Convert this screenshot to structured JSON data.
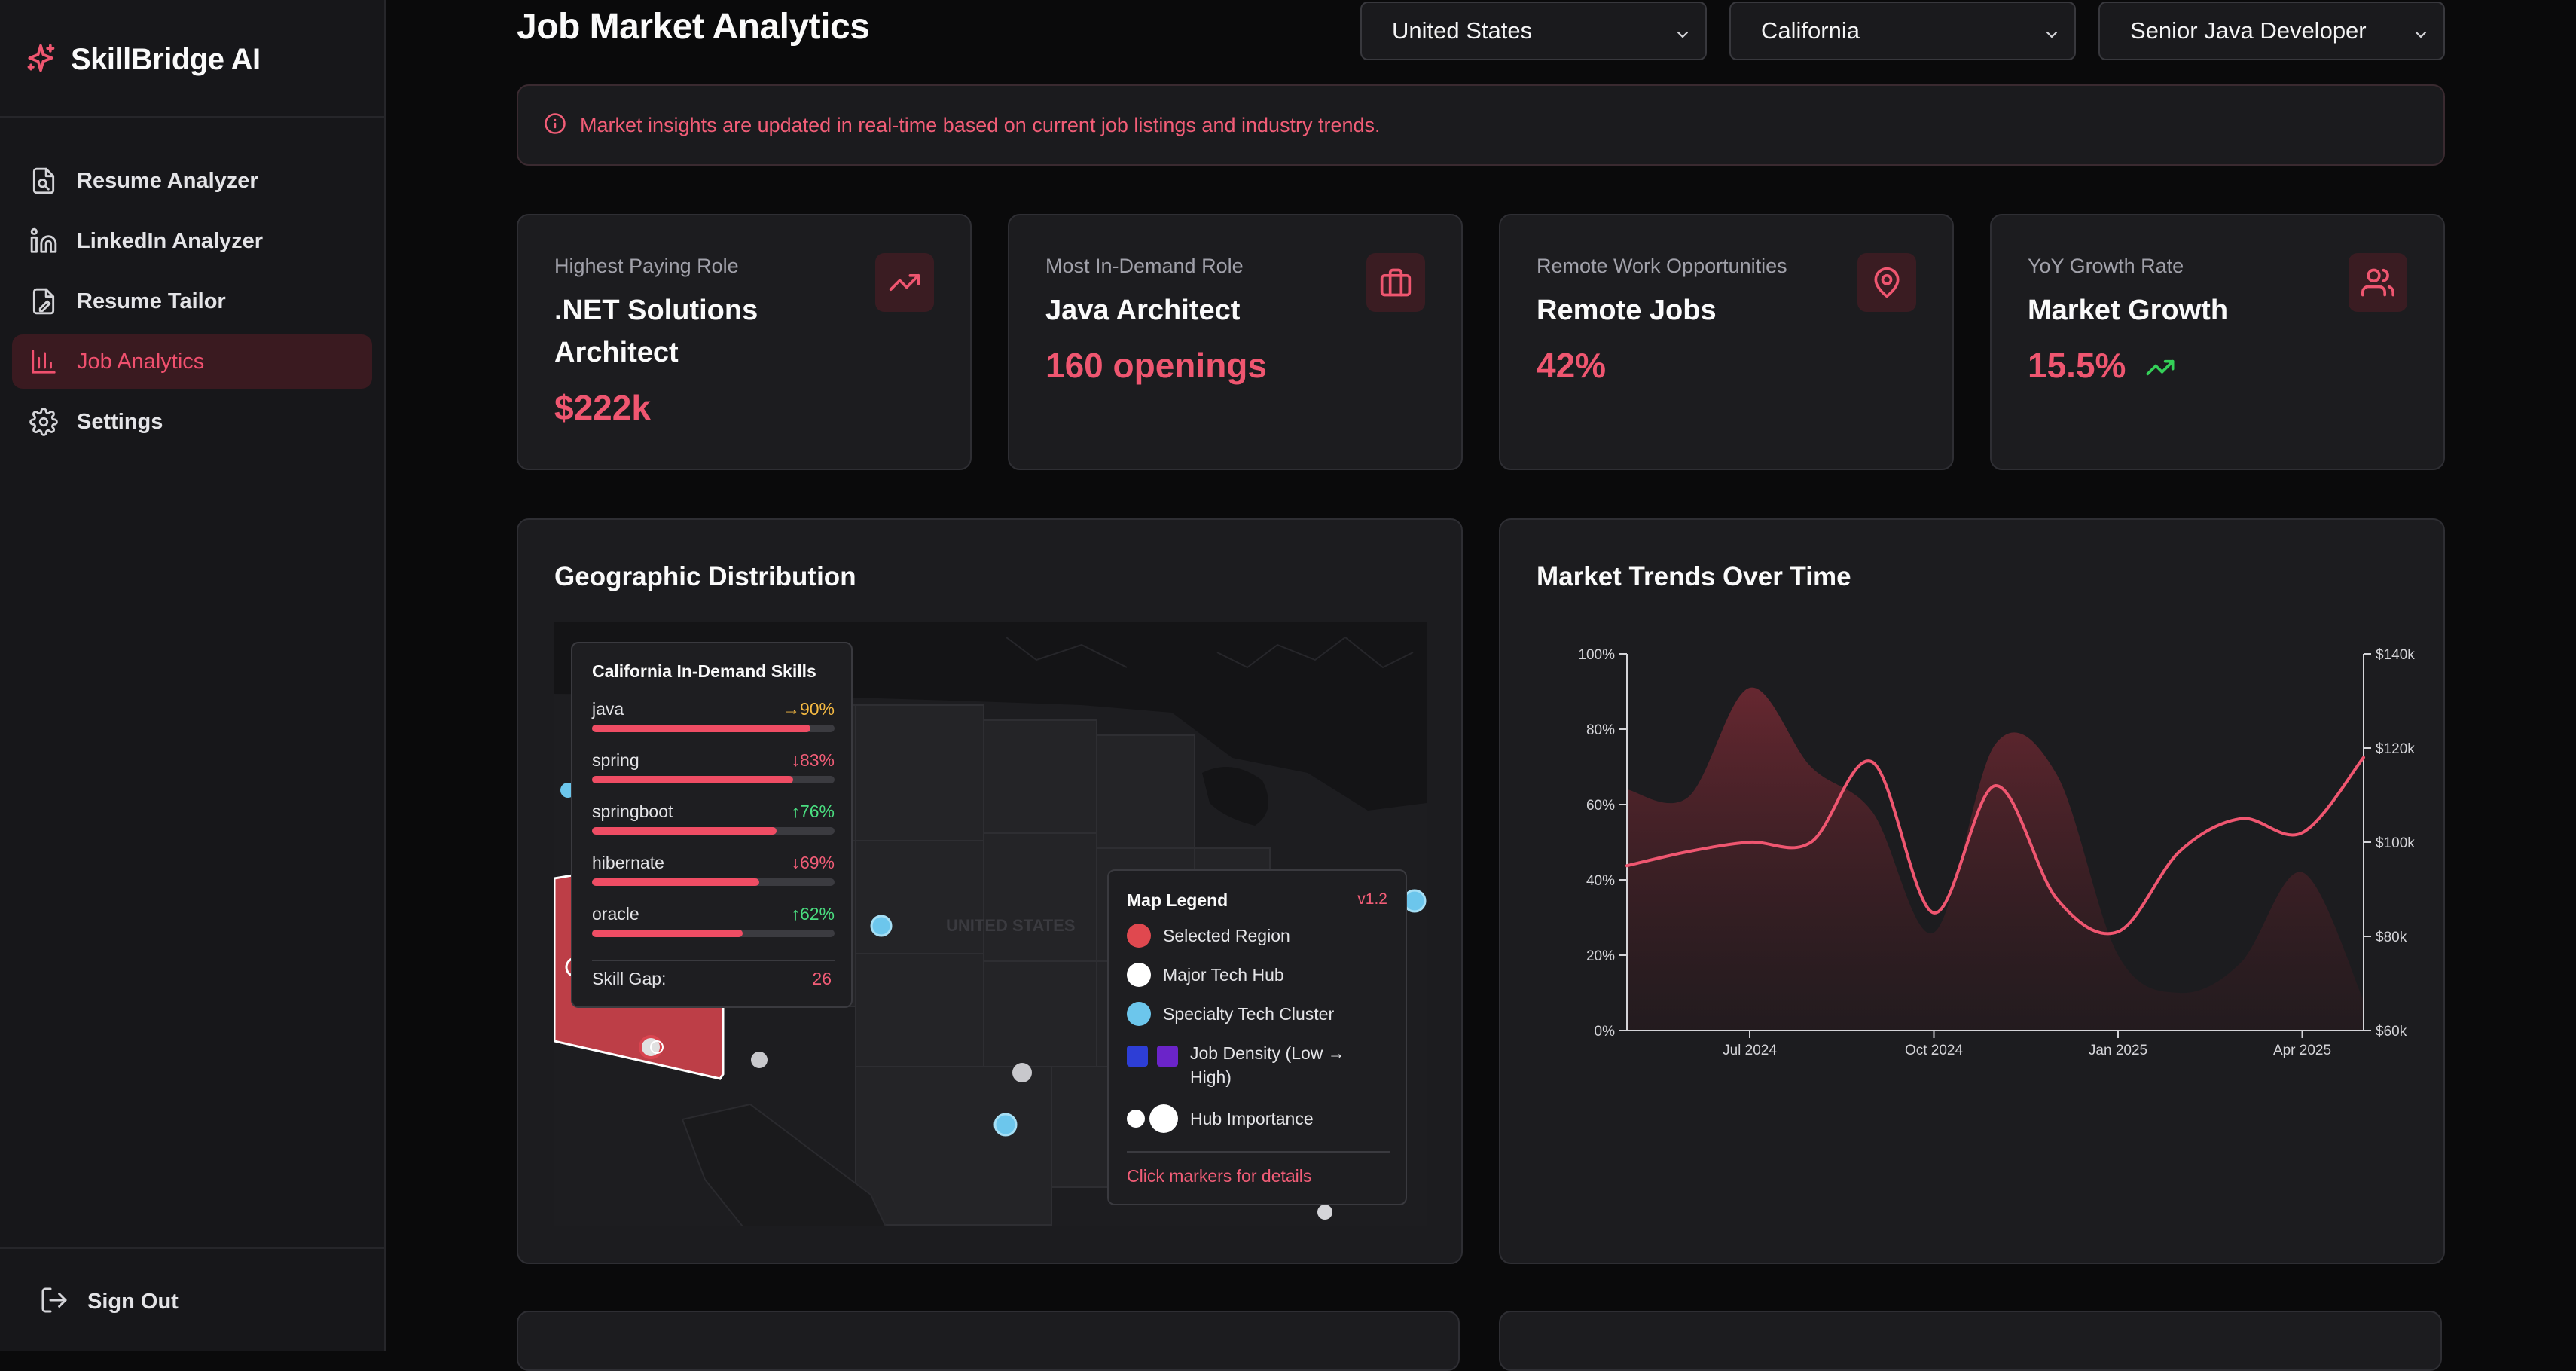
{
  "app": {
    "name": "SkillBridge AI"
  },
  "sidebar": {
    "items": [
      {
        "label": "Resume Analyzer",
        "icon": "file-search-icon"
      },
      {
        "label": "LinkedIn Analyzer",
        "icon": "linkedin-icon"
      },
      {
        "label": "Resume Tailor",
        "icon": "file-edit-icon"
      },
      {
        "label": "Job Analytics",
        "icon": "bar-chart-icon",
        "active": true
      },
      {
        "label": "Settings",
        "icon": "gear-icon"
      }
    ],
    "sign_out": "Sign Out"
  },
  "header": {
    "title": "Job Market Analytics",
    "filters": {
      "country": "United States",
      "region": "California",
      "role": "Senior Java Developer"
    }
  },
  "banner": {
    "text": "Market insights are updated in real-time based on current job listings and industry trends."
  },
  "stats": [
    {
      "label": "Highest Paying Role",
      "title": ".NET Solutions Architect",
      "value": "$222k",
      "icon": "trending-up-icon"
    },
    {
      "label": "Most In-Demand Role",
      "title": "Java Architect",
      "value": "160 openings",
      "icon": "briefcase-icon"
    },
    {
      "label": "Remote Work Opportunities",
      "title": "Remote Jobs",
      "value": "42%",
      "icon": "map-pin-icon"
    },
    {
      "label": "YoY Growth Rate",
      "title": "Market Growth",
      "value": "15.5%",
      "icon": "users-icon"
    }
  ],
  "geo": {
    "title": "Geographic Distribution",
    "map_label": "UNITED STATES",
    "skills": {
      "title": "California In-Demand Skills",
      "items": [
        {
          "name": "java",
          "pct": "→90%",
          "trend": "flat",
          "fill": 0.9
        },
        {
          "name": "spring",
          "pct": "↓83%",
          "trend": "down",
          "fill": 0.83
        },
        {
          "name": "springboot",
          "pct": "↑76%",
          "trend": "up",
          "fill": 0.76
        },
        {
          "name": "hibernate",
          "pct": "↓69%",
          "trend": "down",
          "fill": 0.69
        },
        {
          "name": "oracle",
          "pct": "↑62%",
          "trend": "up",
          "fill": 0.62
        }
      ],
      "gap_label": "Skill Gap:",
      "gap_value": "26"
    },
    "legend": {
      "title": "Map Legend",
      "version": "v1.2",
      "items": [
        {
          "label": "Selected Region",
          "color": "#e0484f"
        },
        {
          "label": "Major Tech Hub",
          "color": "#ffffff"
        },
        {
          "label": "Specialty Tech Cluster",
          "color": "#6cc6ec"
        },
        {
          "label": "Job Density (Low → High)",
          "colors": [
            "#2d3ed6",
            "#6b24c9"
          ]
        },
        {
          "label": "Hub Importance"
        }
      ],
      "footer": "Click markers for details"
    }
  },
  "trends": {
    "title": "Market Trends Over Time"
  },
  "chart_data": {
    "type": "line",
    "title": "Market Trends Over Time",
    "x": [
      "2024-05",
      "2024-06",
      "2024-07",
      "2024-08",
      "2024-09",
      "2024-10",
      "2024-11",
      "2024-12",
      "2025-01",
      "2025-02",
      "2025-03",
      "2025-04",
      "2025-05"
    ],
    "x_tick_labels": [
      "Jul 2024",
      "Oct 2024",
      "Jan 2025",
      "Apr 2025"
    ],
    "left_axis": {
      "ticks": [
        "0%",
        "20%",
        "40%",
        "60%",
        "80%",
        "100%"
      ],
      "ylim": [
        0,
        100
      ]
    },
    "right_axis": {
      "ticks": [
        "$60k",
        "$80k",
        "$100k",
        "$120k",
        "$140k"
      ],
      "ylim": [
        60,
        140
      ]
    },
    "series": [
      {
        "axis": "left",
        "kind": "area",
        "color": "#5a242c",
        "values": [
          64,
          62,
          91,
          70,
          58,
          26,
          76,
          68,
          20,
          10,
          18,
          42,
          8
        ]
      },
      {
        "axis": "right",
        "kind": "line",
        "color": "#ef5670",
        "values": [
          95,
          98,
          100,
          100,
          117,
          85,
          112,
          88,
          81,
          98,
          105,
          102,
          118
        ]
      }
    ]
  }
}
